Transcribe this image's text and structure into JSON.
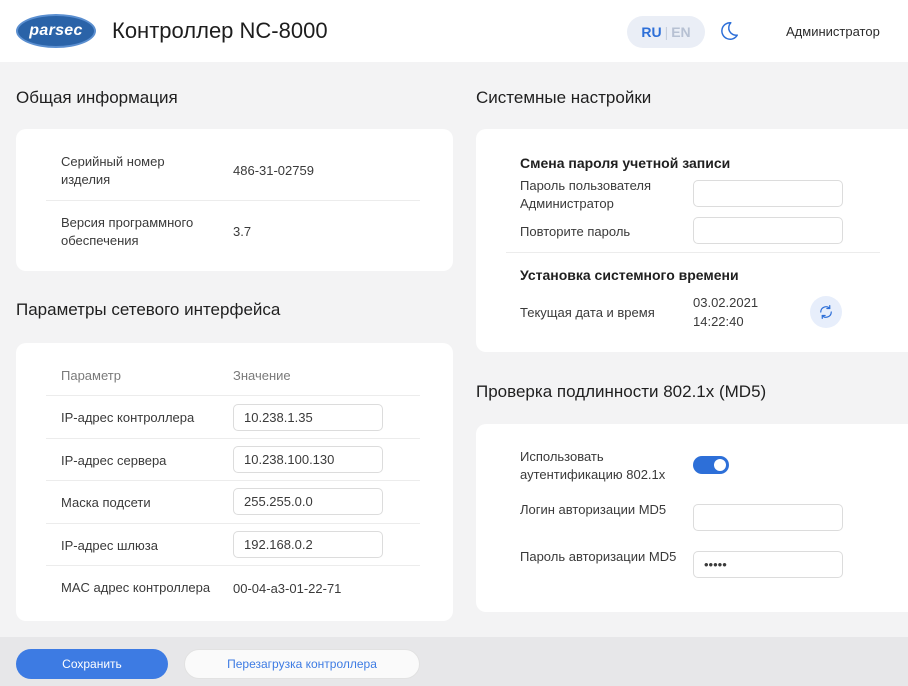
{
  "header": {
    "logo_text": "parsec",
    "title": "Контроллер NC-8000",
    "lang_ru": "RU",
    "lang_en": "EN",
    "user": "Администратор"
  },
  "general": {
    "title": "Общая информация",
    "serial_label": "Серийный номер изделия",
    "serial_value": "486-31-02759",
    "firmware_label": "Версия программного обеспечения",
    "firmware_value": "3.7"
  },
  "network": {
    "title": "Параметры сетевого интерфейса",
    "col_param": "Параметр",
    "col_value": "Значение",
    "rows": [
      {
        "label": "IP-адрес контроллера",
        "value": "10.238.1.35"
      },
      {
        "label": "IP-адрес сервера",
        "value": "10.238.100.130"
      },
      {
        "label": "Маска подсети",
        "value": "255.255.0.0"
      },
      {
        "label": "IP-адрес шлюза",
        "value": "192.168.0.2"
      },
      {
        "label": "MAC адрес контроллера",
        "value": "00-04-a3-01-22-71"
      }
    ]
  },
  "system": {
    "title": "Системные настройки",
    "password_title": "Смена пароля учетной записи",
    "user_password_label": "Пароль пользователя Администратор",
    "user_password_value": "",
    "repeat_password_label": "Повторите пароль",
    "repeat_password_value": "",
    "time_title": "Установка системного времени",
    "datetime_label": "Текущая дата и время",
    "date_value": "03.02.2021",
    "time_value": "14:22:40"
  },
  "auth": {
    "title": "Проверка подлинности 802.1x (MD5)",
    "use_label": "Использовать аутентификацию 802.1x",
    "use_enabled": true,
    "login_label": "Логин авторизации MD5",
    "login_value": "",
    "password_label": "Пароль авторизации MD5",
    "password_value": "•••••"
  },
  "footer": {
    "save_label": "Сохранить",
    "reboot_label": "Перезагрузка контроллера"
  }
}
